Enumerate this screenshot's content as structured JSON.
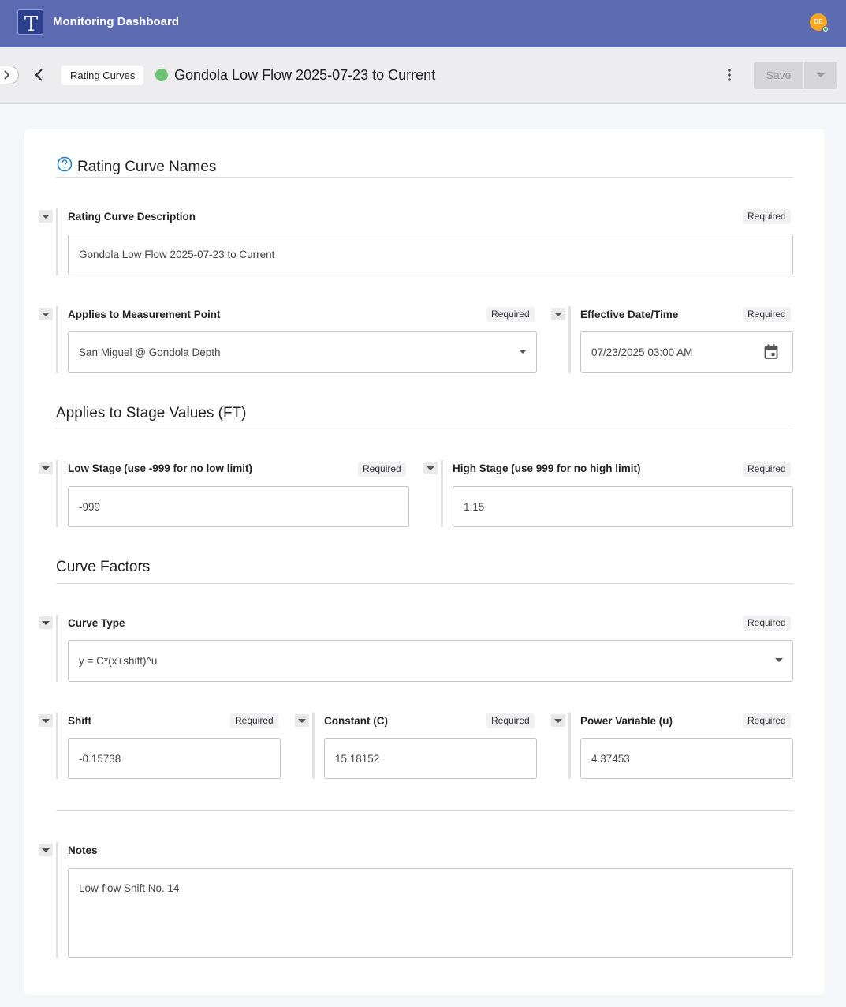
{
  "app": {
    "title": "Monitoring Dashboard",
    "logo_letter": "T",
    "user_initials": "DE"
  },
  "header": {
    "breadcrumb": "Rating Curves",
    "title": "Gondola Low Flow 2025-07-23 to Current",
    "status_color": "#6cc072",
    "save_label": "Save"
  },
  "sections": {
    "names": "Rating Curve Names",
    "stage": "Applies to Stage Values (FT)",
    "factors": "Curve Factors"
  },
  "fields": {
    "description": {
      "label": "Rating Curve Description",
      "required": "Required",
      "value": "Gondola Low Flow 2025-07-23 to Current"
    },
    "measurement_point": {
      "label": "Applies to Measurement Point",
      "required": "Required",
      "value": "San Miguel @ Gondola Depth"
    },
    "effective_date": {
      "label": "Effective Date/Time",
      "required": "Required",
      "value": "07/23/2025 03:00 AM"
    },
    "low_stage": {
      "label": "Low Stage (use -999 for no low limit)",
      "required": "Required",
      "value": "-999"
    },
    "high_stage": {
      "label": "High Stage (use 999 for no high limit)",
      "required": "Required",
      "value": "1.15"
    },
    "curve_type": {
      "label": "Curve Type",
      "required": "Required",
      "value": "y = C*(x+shift)^u"
    },
    "shift": {
      "label": "Shift",
      "required": "Required",
      "value": "-0.15738"
    },
    "constant": {
      "label": "Constant (C)",
      "required": "Required",
      "value": "15.18152"
    },
    "power": {
      "label": "Power Variable (u)",
      "required": "Required",
      "value": "4.37453"
    },
    "notes": {
      "label": "Notes",
      "value": "Low-flow Shift No. 14"
    }
  },
  "icons": {
    "help": "question-circle-icon",
    "calendar": "calendar-icon",
    "back": "chevron-left-icon",
    "expand": "chevron-right-icon",
    "more": "more-vertical-icon"
  }
}
